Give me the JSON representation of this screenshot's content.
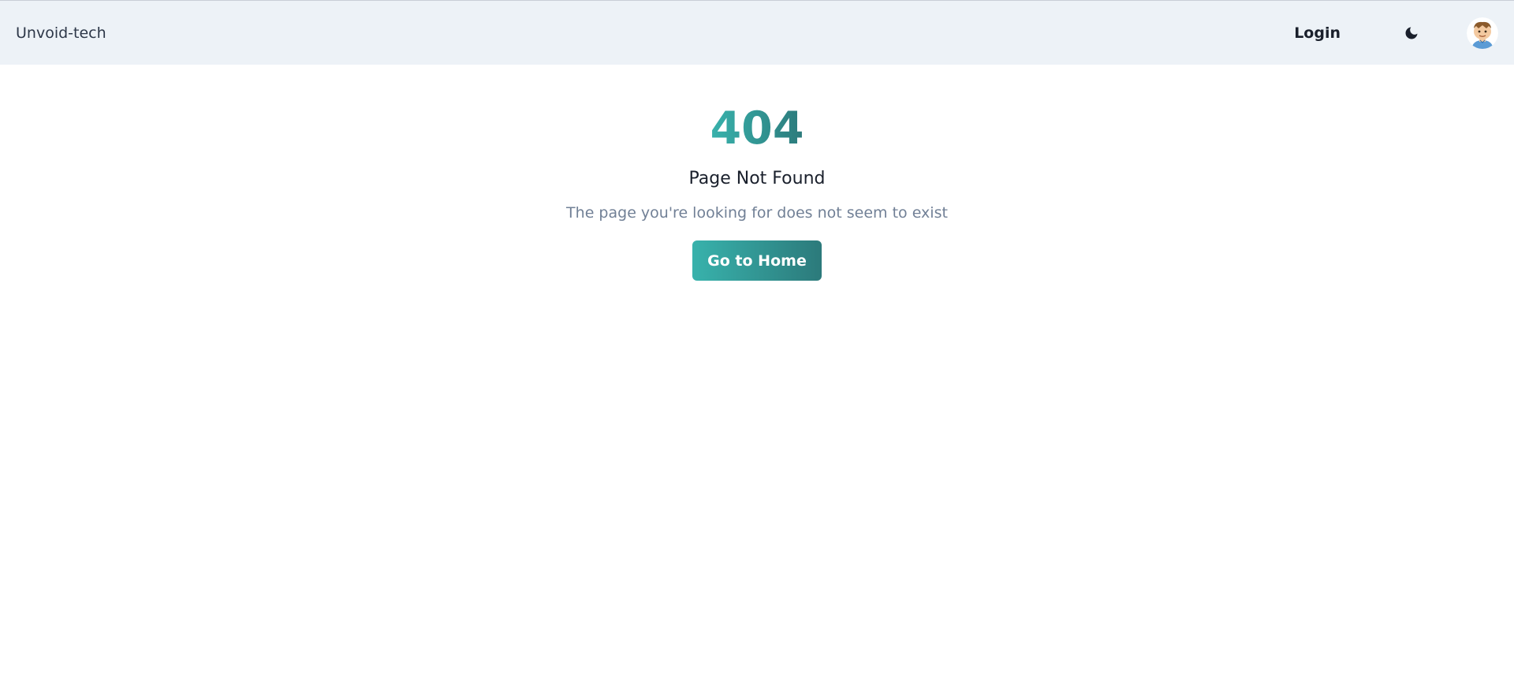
{
  "navbar": {
    "brand": "Unvoid-tech",
    "login_label": "Login",
    "theme_icon": "moon-icon",
    "avatar_icon": "avatar-icon"
  },
  "error": {
    "code": "404",
    "title": "Page Not Found",
    "description": "The page you're looking for does not seem to exist",
    "home_button": "Go to Home"
  },
  "colors": {
    "navbar_bg": "#edf2f7",
    "accent_start": "#38b2ac",
    "accent_end": "#2c7a7b",
    "text_primary": "#1a202c",
    "text_muted": "#718096"
  }
}
